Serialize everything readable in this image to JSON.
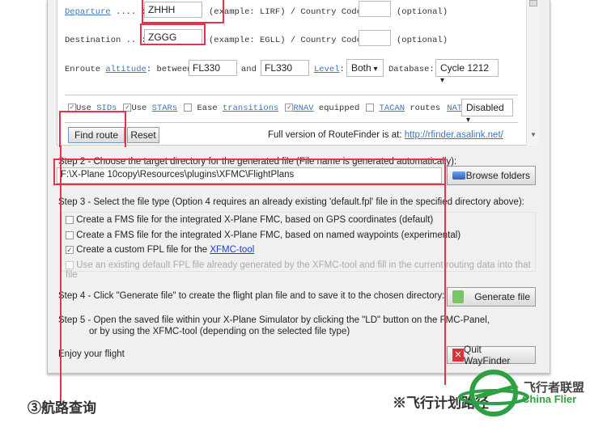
{
  "form": {
    "departure_label": "Departure",
    "departure_dots": " .... :",
    "departure_value": "ZHHH",
    "departure_example": "(example: LIRF) / Country Code:",
    "optional": "(optional)",
    "destination_label": "Destination .. :",
    "destination_value": "ZGGG",
    "destination_example": "(example: EGLL) / Country Code:",
    "enroute": "Enroute ",
    "altitude_link": "altitude",
    "between": ": between",
    "alt_from": "FL330",
    "and": "and",
    "alt_to": "FL330",
    "level_link": "Level",
    "level_value": "Both",
    "database_label": "Database:",
    "database_value": "Cycle 1212",
    "options": [
      {
        "pre": "Use ",
        "link": "SIDs",
        "post": "",
        "checked": true
      },
      {
        "pre": "Use ",
        "link": "STARs",
        "post": "",
        "checked": true
      },
      {
        "pre": "Ease ",
        "link": "transitions",
        "post": "",
        "checked": false
      },
      {
        "pre": "",
        "link": "RNAV",
        "post": " equipped",
        "checked": true
      },
      {
        "pre": "",
        "link": "TACAN",
        "post": " routes",
        "checked": false
      }
    ],
    "nats_link": "NATs",
    "nats_value": "Disabled",
    "find_route": "Find route",
    "reset": "Reset",
    "full_version_text": "Full version of RouteFinder is at: ",
    "full_version_link": "http://rfinder.asalink.net/"
  },
  "step2": {
    "label": "Step 2 - Choose the target directory for the generated file (File name is generated automatically):",
    "path": "F:\\X-Plane 10copy\\Resources\\plugins\\XFMC\\FlightPlans",
    "browse": "Browse folders"
  },
  "step3": {
    "label": "Step 3 - Select the file type (Option 4 requires an already existing 'default.fpl' file in the specified directory above):",
    "options": [
      {
        "text": "Create a FMS file for the integrated X-Plane FMC, based on GPS coordinates (default)",
        "checked": false,
        "disabled": false
      },
      {
        "text": "Create a FMS file for the integrated X-Plane FMC, based on named waypoints (experimental)",
        "checked": false,
        "disabled": false
      },
      {
        "text": "Create a custom FPL file for the ",
        "link": "XFMC-tool",
        "checked": true,
        "disabled": false
      },
      {
        "text": "Use an existing default FPL file already generated by the XFMC-tool and fill in the current routing data into that file",
        "checked": false,
        "disabled": true
      }
    ]
  },
  "step4": {
    "label": "Step 4 - Click \"Generate file\" to create the flight plan file and to save it to the chosen directory:",
    "button": "Generate file"
  },
  "step5": {
    "line1": "Step 5 - Open the saved file within your X-Plane Simulator by clicking the \"LD\" button on the FMC-Panel,",
    "line2": "or by using the XFMC-tool (depending on the selected file type)"
  },
  "enjoy": "Enjoy your flight",
  "quit": "Quit WayFinder",
  "annotations": {
    "route_query": "③航路查询",
    "flight_plan_path": "※飞行计划路径"
  },
  "logo": {
    "cn": "飞行者联盟",
    "en": "China Flier",
    "color": "#2ea043"
  },
  "colors": {
    "annotation": "#e8314d",
    "link": "#3a76b8"
  }
}
